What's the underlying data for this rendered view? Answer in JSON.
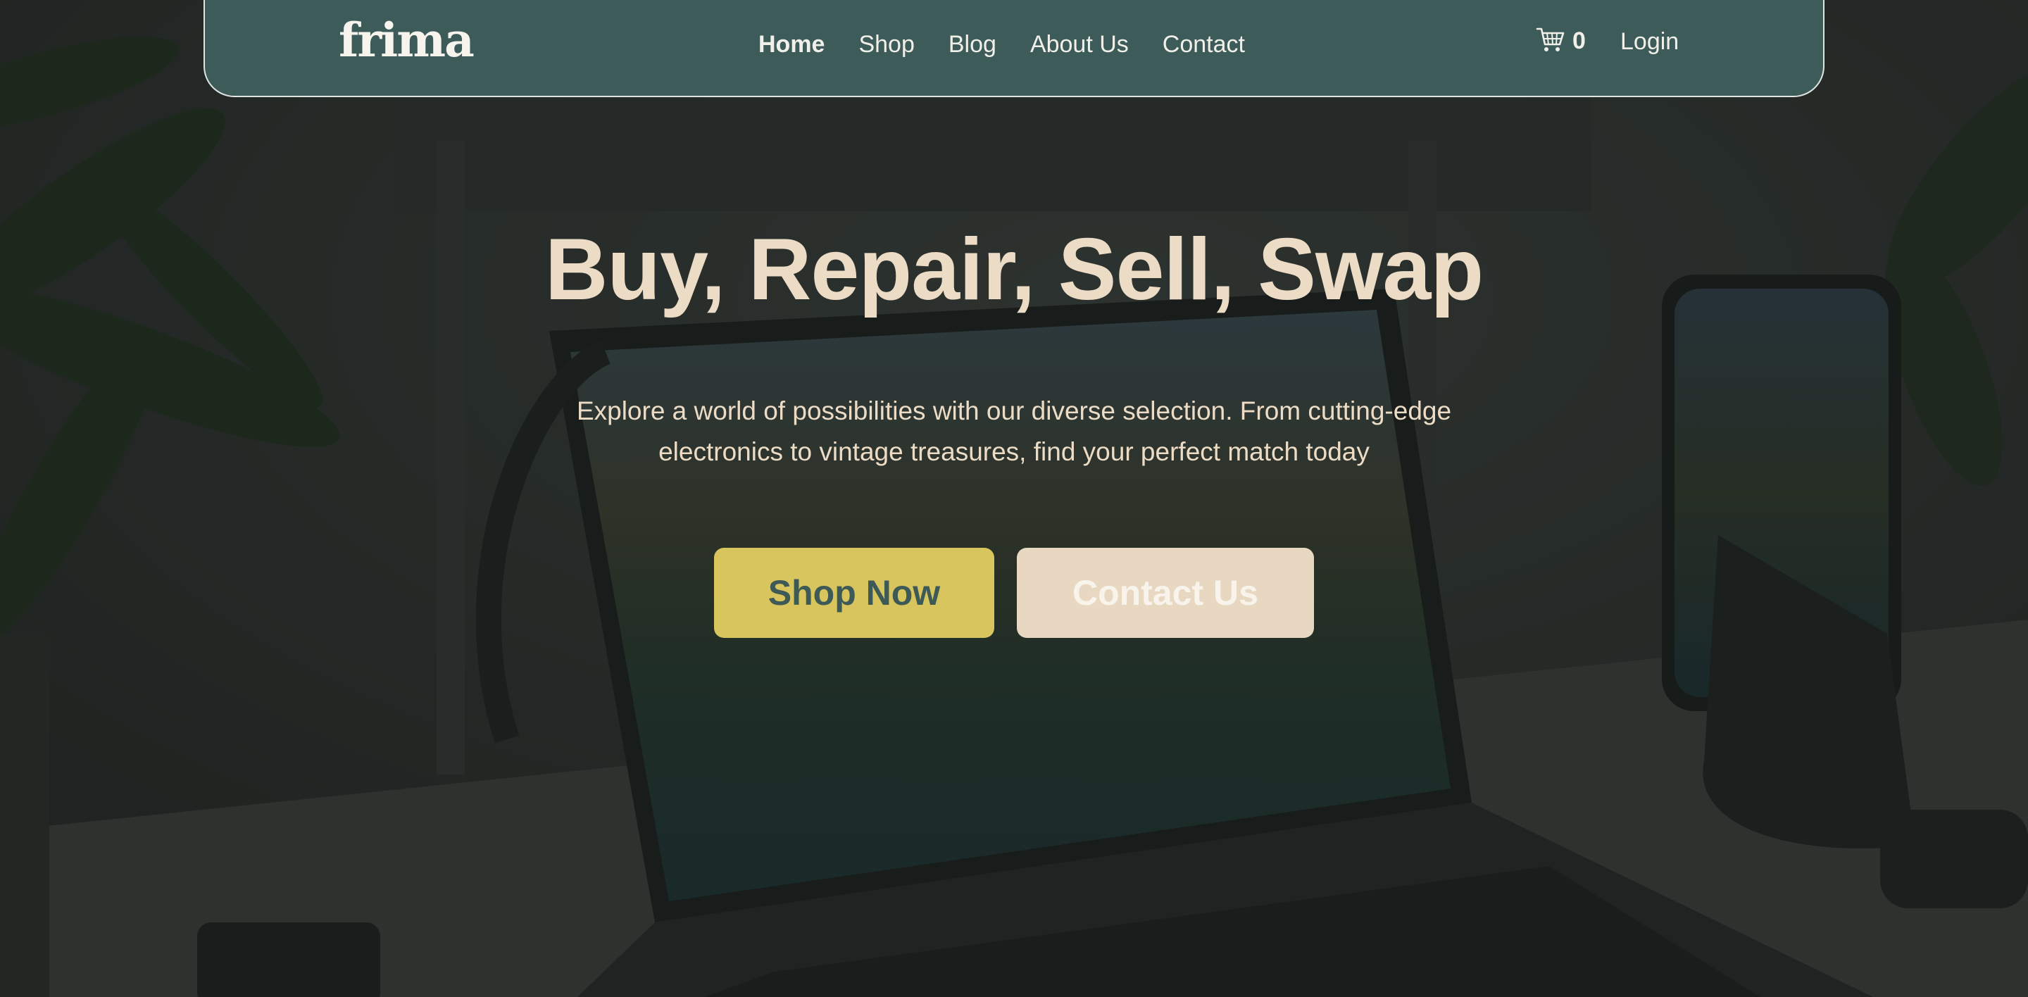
{
  "brand": {
    "logo_text": "frima"
  },
  "nav": {
    "items": [
      {
        "label": "Home",
        "active": true
      },
      {
        "label": "Shop",
        "active": false
      },
      {
        "label": "Blog",
        "active": false
      },
      {
        "label": "About Us",
        "active": false
      },
      {
        "label": "Contact",
        "active": false
      }
    ],
    "cart_icon": "cart-icon",
    "cart_count": "0",
    "login_label": "Login"
  },
  "hero": {
    "title": "Buy, Repair, Sell, Swap",
    "subtitle_line1": "Explore a world of possibilities with our diverse selection. From cutting-edge",
    "subtitle_line2": "electronics to vintage treasures, find your perfect match today",
    "primary_cta": "Shop Now",
    "secondary_cta": "Contact Us"
  },
  "colors": {
    "nav_bg": "#3d5b58",
    "title_text": "#ecdcc5",
    "primary_button": "#d9c55e",
    "secondary_button": "#e8d8c1"
  }
}
